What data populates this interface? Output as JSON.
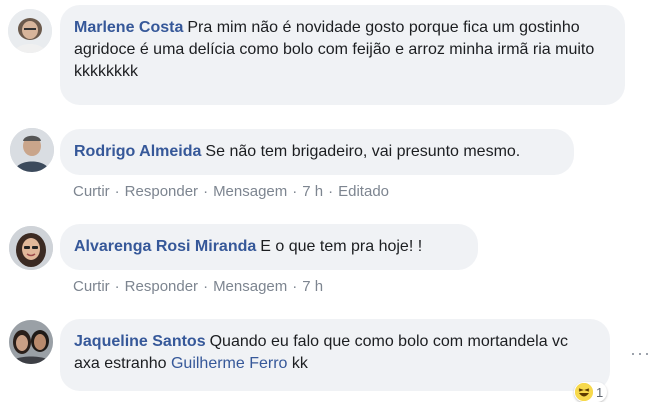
{
  "comments": [
    {
      "author": "Marlene Costa",
      "text": "Pra mim não é novidade gosto porque fica um gostinho agridoce é uma delícia como bolo com feijão e arroz minha irmã ria muito kkkkkkkk"
    },
    {
      "author": "Rodrigo Almeida",
      "text": "Se não tem brigadeiro, vai presunto mesmo.",
      "actions": [
        "Curtir",
        "Responder",
        "Mensagem",
        "7 h",
        "Editado"
      ]
    },
    {
      "author": "Alvarenga Rosi Miranda",
      "text": "E o que tem pra hoje! !",
      "actions": [
        "Curtir",
        "Responder",
        "Mensagem",
        "7 h"
      ]
    },
    {
      "author": "Jaqueline Santos",
      "text_before": "Quando eu falo que como bolo com mortandela vc axa estranho",
      "mention": "Guilherme Ferro",
      "text_after": "kk",
      "reaction": {
        "icon": "haha-reaction-icon",
        "count": "1"
      }
    }
  ]
}
